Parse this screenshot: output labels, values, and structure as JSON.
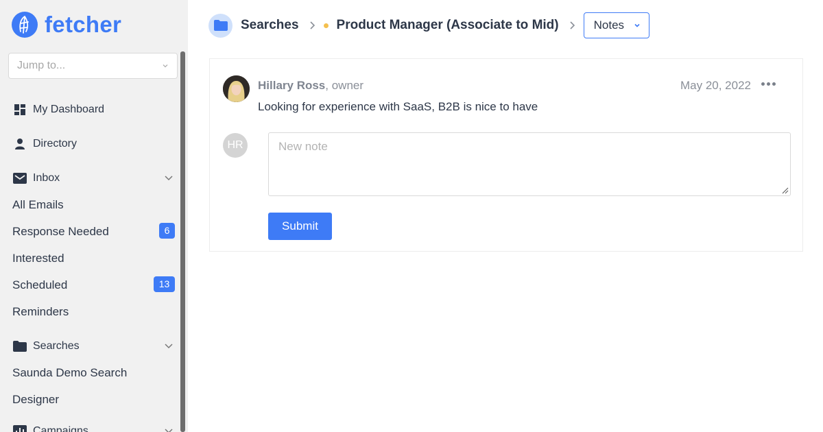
{
  "app": {
    "name": "fetcher",
    "brand_color": "#3e7bf6"
  },
  "sidebar": {
    "jump_placeholder": "Jump to...",
    "nav": {
      "dashboard": "My Dashboard",
      "directory": "Directory",
      "inbox": "Inbox",
      "searches": "Searches",
      "campaigns": "Campaigns"
    },
    "inbox_items": [
      {
        "label": "All Emails"
      },
      {
        "label": "Response Needed",
        "count": "6"
      },
      {
        "label": "Interested"
      },
      {
        "label": "Scheduled",
        "count": "13"
      },
      {
        "label": "Reminders"
      }
    ],
    "search_items": [
      {
        "label": "Saunda Demo Search"
      },
      {
        "label": "Designer"
      }
    ]
  },
  "breadcrumb": {
    "root": "Searches",
    "search": "Product Manager (Associate to Mid)",
    "status_color": "#f4c04f",
    "view": "Notes"
  },
  "note": {
    "author": "Hillary Ross",
    "role": ", owner",
    "date": "May 20, 2022",
    "body": "Looking for experience with SaaS, B2B is nice to have"
  },
  "composer": {
    "initials": "HR",
    "placeholder": "New note",
    "submit_label": "Submit"
  }
}
